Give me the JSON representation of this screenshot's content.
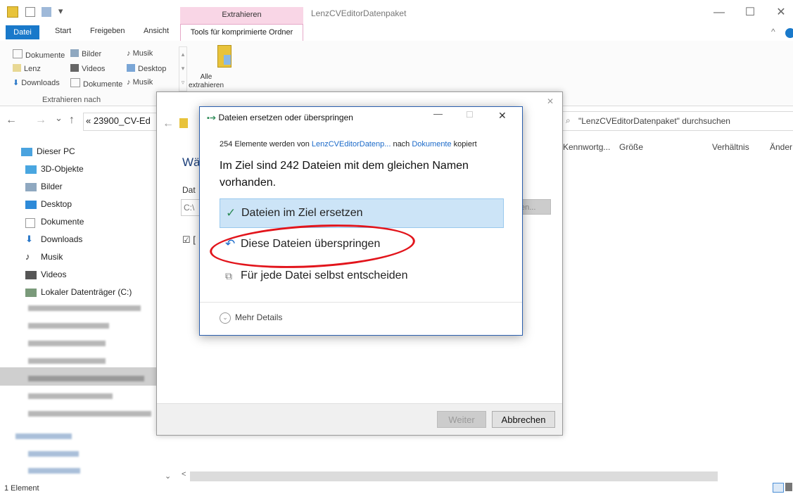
{
  "titlebar": {
    "context_tab": "Extrahieren",
    "window_title": "LenzCVEditorDatenpaket",
    "min": "—",
    "max": "☐",
    "close": "✕"
  },
  "ribbon": {
    "tabs": [
      "Datei",
      "Start",
      "Freigeben",
      "Ansicht",
      "Tools für komprimierte Ordner"
    ],
    "items": {
      "dokumente1": "Dokumente",
      "bilder": "Bilder",
      "musik1": "Musik",
      "lenz": "Lenz",
      "videos": "Videos",
      "desktop": "Desktop",
      "downloads": "Downloads",
      "dokumente2": "Dokumente",
      "musik2": "Musik"
    },
    "group_label": "Extrahieren nach",
    "alle_extrahieren": [
      "Alle",
      "extrahieren"
    ],
    "collapse": "^"
  },
  "addressbar": {
    "back": "←",
    "forward": "→",
    "recent": "⌄",
    "up": "↑",
    "breadcrumb": "«  23900_CV-Ed",
    "search_placeholder": "\"LenzCVEditorDatenpaket\" durchsuchen"
  },
  "sidebar": {
    "items": [
      "Dieser PC",
      "3D-Objekte",
      "Bilder",
      "Desktop",
      "Dokumente",
      "Downloads",
      "Musik",
      "Videos",
      "Lokaler Datenträger (C:)"
    ]
  },
  "columns": [
    "Kennwortg...",
    "Größe",
    "Verhältnis",
    "Änder"
  ],
  "wizard": {
    "heading_partial": "Wä",
    "label_partial": "Dat",
    "path_partial": "C:\\",
    "browse_partial": "en...",
    "checkbox_partial": "☑ [",
    "back_arrow": "←",
    "close": "✕",
    "weiter": "Weiter",
    "abbrechen": "Abbrechen"
  },
  "dialog": {
    "title": "Dateien ersetzen oder überspringen",
    "copy_prefix": "254 Elemente werden von ",
    "copy_source": "LenzCVEditorDatenp...",
    "copy_mid": " nach ",
    "copy_dest": "Dokumente",
    "copy_suffix": " kopiert",
    "heading": "Im Ziel sind 242 Dateien mit dem gleichen Namen vorhanden.",
    "option_replace": "Dateien im Ziel ersetzen",
    "option_skip": "Diese Dateien überspringen",
    "option_decide": "Für jede Datei selbst entscheiden",
    "more_details": "Mehr Details",
    "min": "—",
    "max": "☐",
    "close": "✕"
  },
  "status": {
    "count": "1 Element"
  },
  "colors": {
    "accent": "#1979ca",
    "selection": "#cce4f7",
    "annotation": "#e2141b",
    "context_tab": "#f9d6e6"
  }
}
